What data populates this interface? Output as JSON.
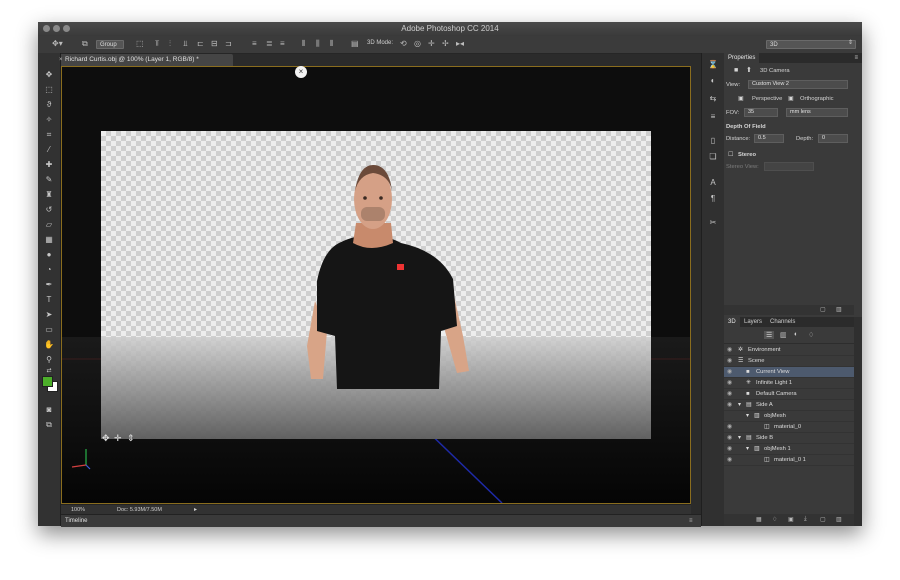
{
  "app_title": "Adobe Photoshop CC 2014",
  "options_bar": {
    "auto_select_value": "Group",
    "mode_3d_label": "3D Mode:",
    "workspace_value": "3D"
  },
  "document": {
    "tab_label": "Richard Curtis.obj @ 100% (Layer 1, RGB/8) *",
    "zoom": "100%",
    "doc_size": "Doc: 5.93M/7.50M"
  },
  "timeline_label": "Timeline",
  "properties": {
    "tab": "Properties",
    "section_title": "3D Camera",
    "view_label": "View:",
    "view_value": "Custom View 2",
    "perspective_label": "Perspective",
    "orthographic_label": "Orthographic",
    "fov_label": "FOV:",
    "fov_value": "35",
    "fov_unit": "mm lens",
    "dof_label": "Depth Of Field",
    "distance_label": "Distance:",
    "distance_value": "0.5",
    "depth_label": "Depth:",
    "depth_value": "0",
    "stereo_label": "Stereo",
    "stereo_view_label": "Stereo View:"
  },
  "layers_panel": {
    "tabs": [
      "3D",
      "Layers",
      "Channels"
    ],
    "items": [
      {
        "label": "Environment"
      },
      {
        "label": "Scene"
      },
      {
        "label": "Current View"
      },
      {
        "label": "Infinite Light 1"
      },
      {
        "label": "Default Camera"
      },
      {
        "label": "Side A"
      },
      {
        "label": "objMesh"
      },
      {
        "label": "material_0"
      },
      {
        "label": "Side B"
      },
      {
        "label": "objMesh 1"
      },
      {
        "label": "material_0 1"
      }
    ]
  },
  "colors": {
    "foreground": "#4caf2a",
    "background": "#ffffff",
    "selection": "#4d5a6e"
  }
}
